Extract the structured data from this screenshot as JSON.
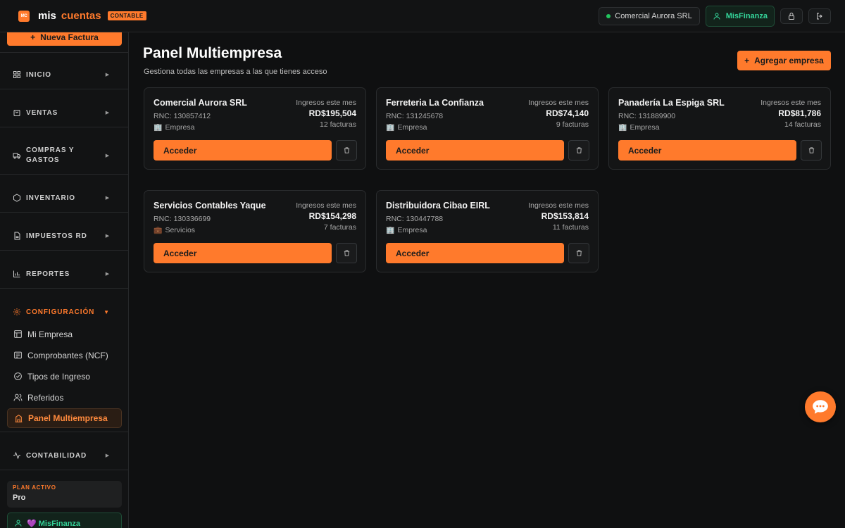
{
  "brand": {
    "logo_mark": "MC",
    "name_part1": "mis",
    "name_part2": "cuentas",
    "badge": "CONTABLE",
    "accent_color": "#ff7a2c"
  },
  "topbar": {
    "current_company": "Comercial Aurora SRL",
    "misfinanza_label": "MisFinanza",
    "lock_icon": "lock-icon",
    "logout_icon": "logout-icon"
  },
  "sidebar": {
    "new_invoice_label": "Nueva Factura",
    "sections": [
      {
        "label": "INICIO",
        "icon": "grid-icon"
      },
      {
        "label": "VENTAS",
        "icon": "bag-icon"
      },
      {
        "label": "COMPRAS Y",
        "label_line2": "GASTOS",
        "icon": "truck-icon"
      },
      {
        "label": "INVENTARIO",
        "icon": "box-icon"
      },
      {
        "label": "IMPUESTOS RD",
        "icon": "document-icon"
      },
      {
        "label": "REPORTES",
        "icon": "bar-chart-icon"
      },
      {
        "label": "CONFIGURACIÓN",
        "icon": "gear-icon"
      },
      {
        "label": "CONTABILIDAD",
        "icon": "activity-icon"
      }
    ],
    "config_items": [
      {
        "label": "Mi Empresa",
        "icon": "layout-icon"
      },
      {
        "label": "Comprobantes (NCF)",
        "icon": "receipt-icon"
      },
      {
        "label": "Tipos de Ingreso",
        "icon": "check-circle-icon"
      },
      {
        "label": "Referidos",
        "icon": "users-icon"
      },
      {
        "label": "Panel Multiempresa",
        "icon": "building-icon"
      }
    ],
    "plan": {
      "label": "PLAN ACTIVO",
      "value": "Pro"
    },
    "misfinanza_label": "💜 MisFinanza"
  },
  "main": {
    "title": "Panel Multiempresa",
    "subtitle": "Gestiona todas las empresas a las que tienes acceso",
    "add_company_label": "Agregar empresa",
    "income_label": "Ingresos este mes",
    "access_label": "Acceder",
    "companies": [
      {
        "name": "Comercial Aurora SRL",
        "rnc": "RNC: 130857412",
        "type": "Empresa",
        "type_icon": "🏢",
        "amount": "RD$195,504",
        "invoices": "12 facturas"
      },
      {
        "name": "Ferreteria La Confianza",
        "rnc": "RNC: 131245678",
        "type": "Empresa",
        "type_icon": "🏢",
        "amount": "RD$74,140",
        "invoices": "9 facturas"
      },
      {
        "name": "Panadería La Espiga SRL",
        "rnc": "RNC: 131889900",
        "type": "Empresa",
        "type_icon": "🏢",
        "amount": "RD$81,786",
        "invoices": "14 facturas"
      },
      {
        "name": "Servicios Contables Yaque",
        "rnc": "RNC: 130336699",
        "type": "Servicios",
        "type_icon": "💼",
        "amount": "RD$154,298",
        "invoices": "7 facturas"
      },
      {
        "name": "Distribuidora Cibao EIRL",
        "rnc": "RNC: 130447788",
        "type": "Empresa",
        "type_icon": "🏢",
        "amount": "RD$153,814",
        "invoices": "11 facturas"
      }
    ]
  },
  "chat_icon": "chat-bubble-icon"
}
